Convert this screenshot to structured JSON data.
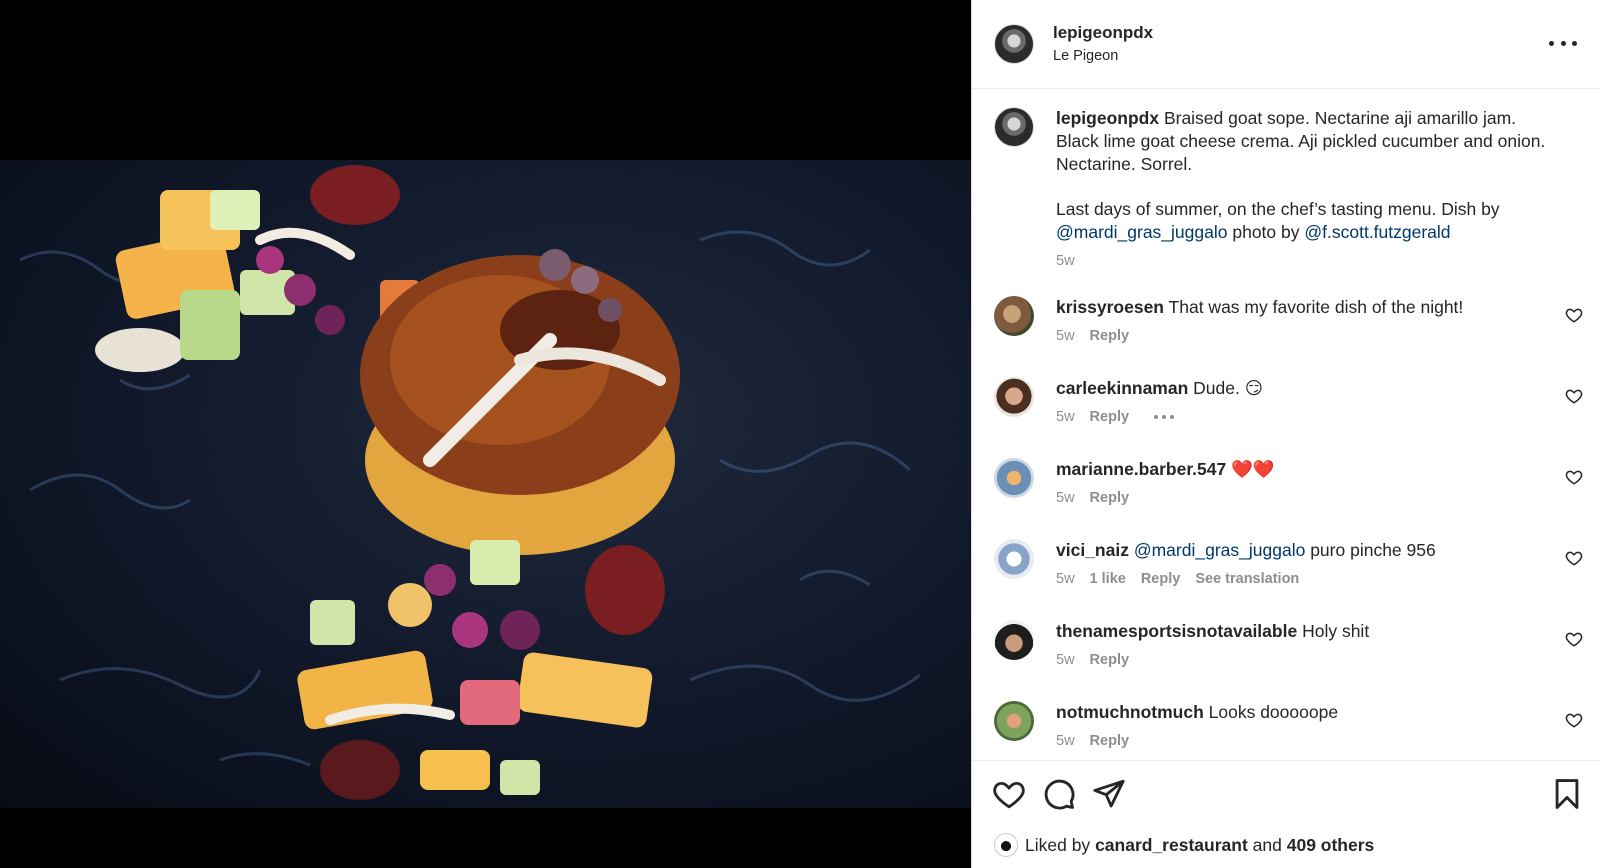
{
  "post": {
    "username": "lepigeonpdx",
    "location": "Le Pigeon"
  },
  "caption": {
    "username": "lepigeonpdx",
    "text_1": "Braised goat sope. Nectarine aji amarillo jam. Black lime goat cheese crema. Aji pickled cucumber and onion. Nectarine. Sorrel.",
    "text_2": "Last days of summer, on the chef’s tasting menu. Dish by",
    "mention_1": "@mardi_gras_juggalo",
    "text_3": "photo by",
    "mention_2": "@f.scott.futzgerald",
    "time": "5w"
  },
  "comments": [
    {
      "username": "krissyroesen",
      "text": "That was my favorite dish of the night!",
      "time": "5w",
      "reply": "Reply"
    },
    {
      "username": "carleekinnaman",
      "text": "Dude. 😏",
      "time": "5w",
      "reply": "Reply"
    },
    {
      "username": "marianne.barber.547",
      "text": "❤️❤️",
      "time": "5w",
      "reply": "Reply"
    },
    {
      "username": "vici_naiz",
      "mention": "@mardi_gras_juggalo",
      "text": "puro pinche 956",
      "time": "5w",
      "likes": "1 like",
      "reply": "Reply",
      "translate": "See translation"
    },
    {
      "username": "thenamesportsisnotavailable",
      "text": "Holy shit",
      "time": "5w",
      "reply": "Reply"
    },
    {
      "username": "notmuchnotmuch",
      "text": "Looks dooooope",
      "time": "5w",
      "reply": "Reply"
    }
  ],
  "likes": {
    "prefix": "Liked by",
    "user": "canard_restaurant",
    "joiner": "and",
    "others": "409 others"
  },
  "icons": [
    "more-icon",
    "heart-icon",
    "comment-icon",
    "share-icon",
    "bookmark-icon"
  ]
}
